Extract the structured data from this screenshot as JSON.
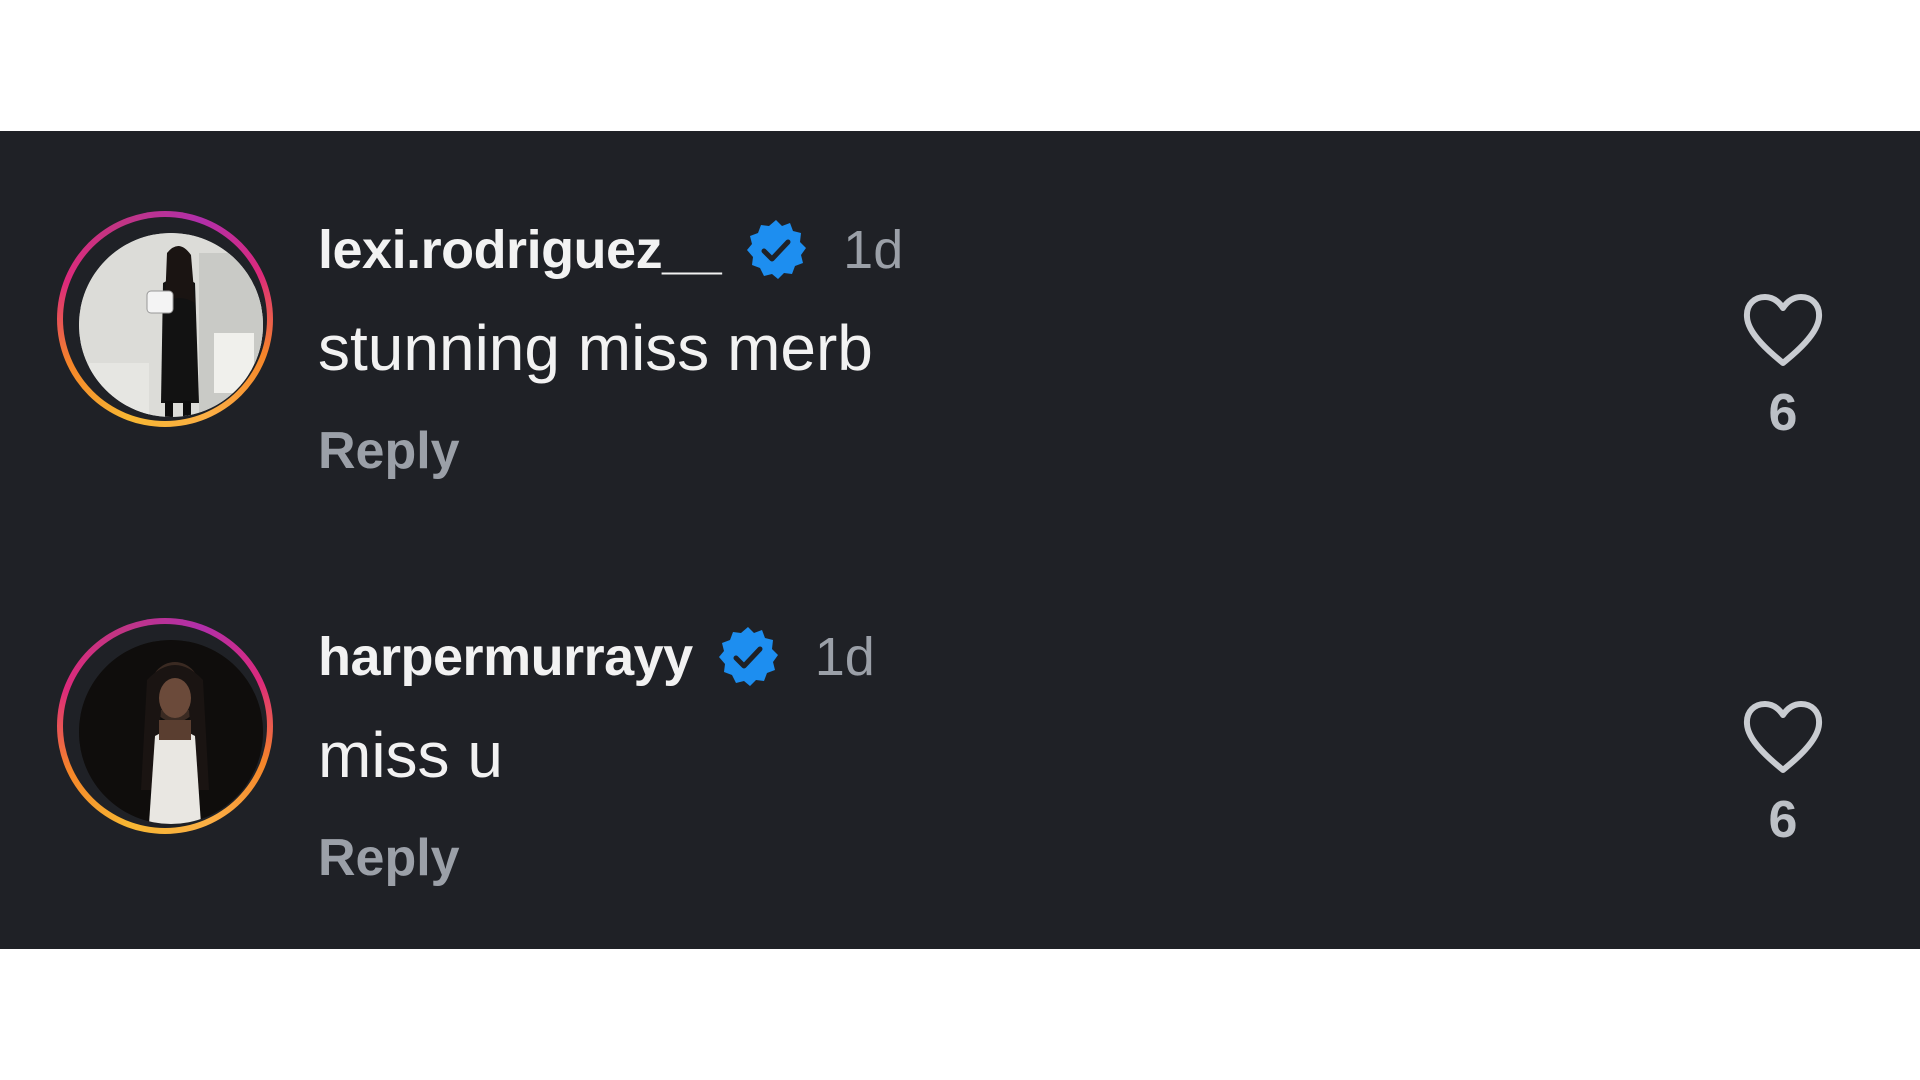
{
  "comments": [
    {
      "username": "lexi.rodriguez__",
      "verified": true,
      "time": "1d",
      "text": "stunning miss merb",
      "reply_label": "Reply",
      "likes": "6",
      "avatar_icon": "profile-photo"
    },
    {
      "username": "harpermurrayy",
      "verified": true,
      "time": "1d",
      "text": "miss u",
      "reply_label": "Reply",
      "likes": "6",
      "avatar_icon": "profile-photo"
    }
  ],
  "colors": {
    "background": "#1f2126",
    "verified_badge": "#1d8ef0",
    "primary_text": "#f2f2f2",
    "secondary_text": "#9ba0a8"
  }
}
